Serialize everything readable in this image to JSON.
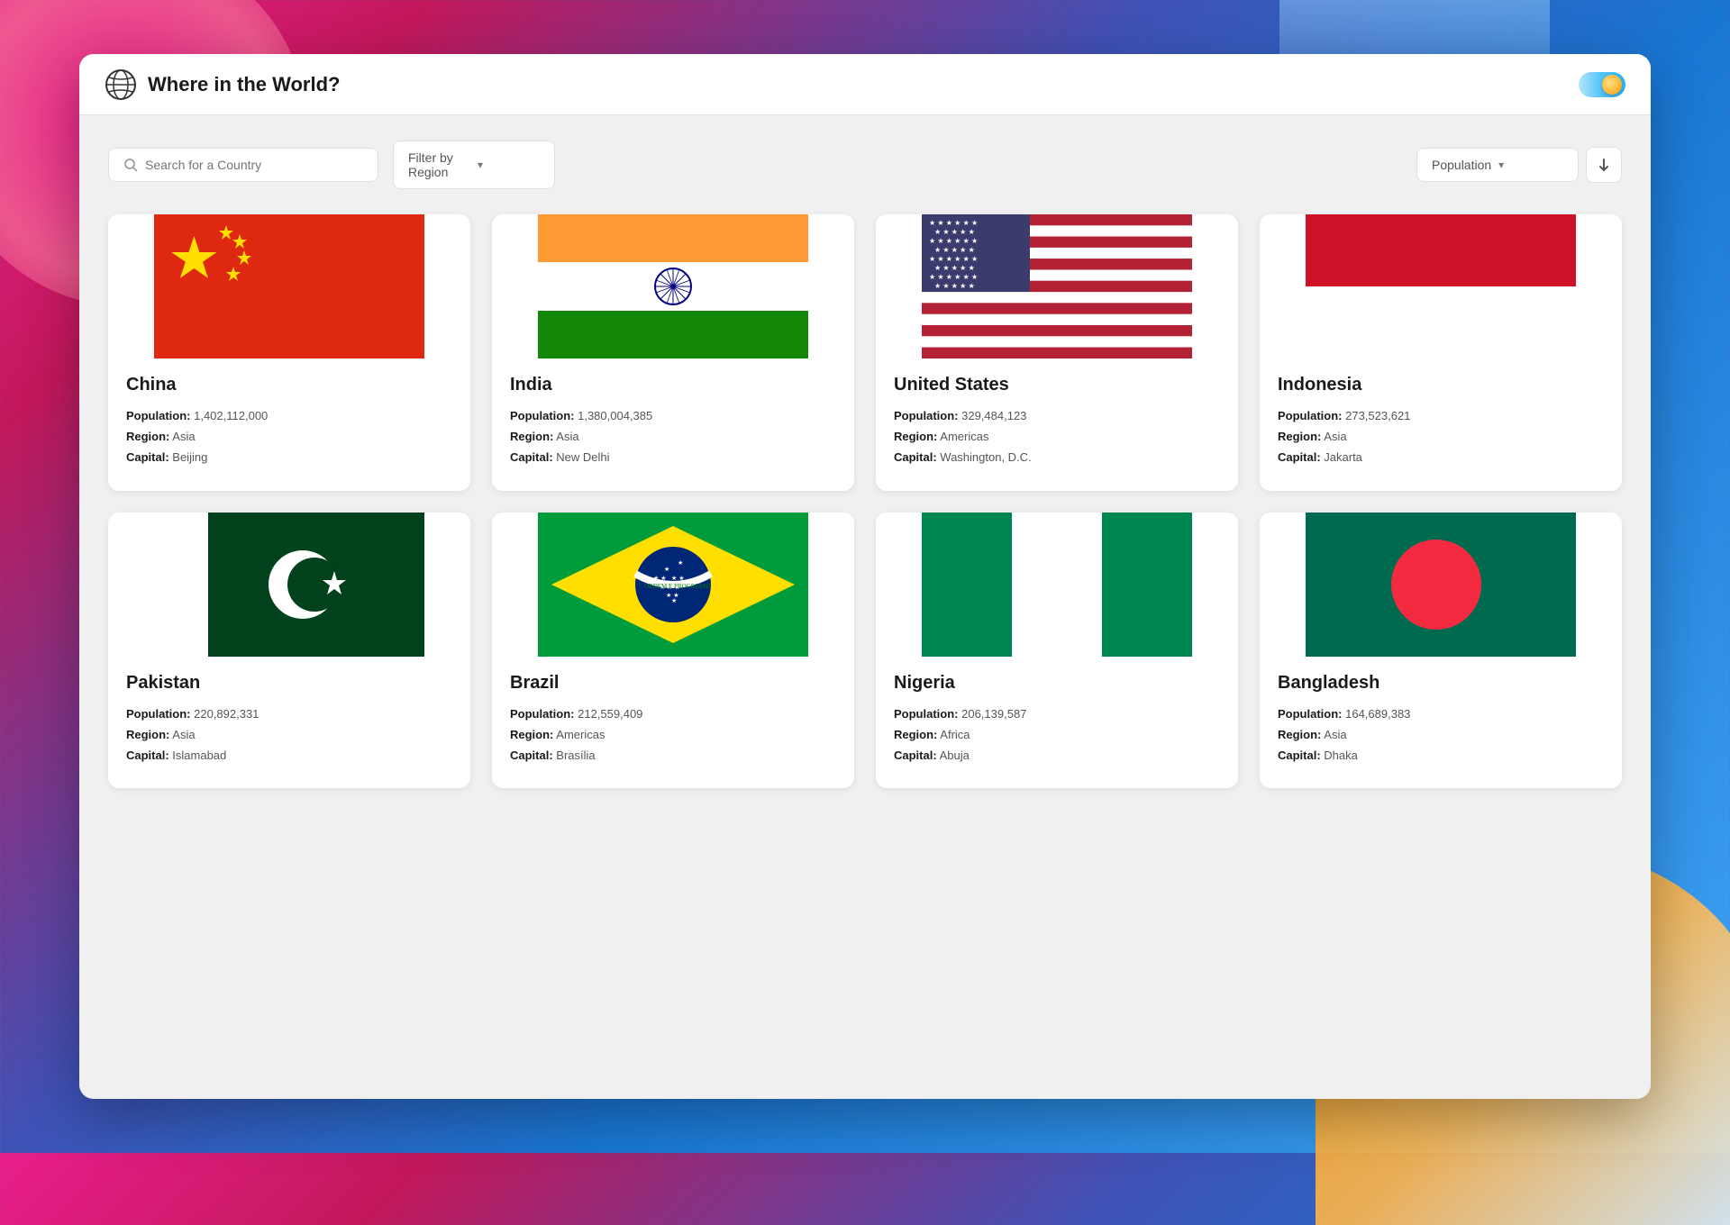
{
  "app": {
    "title": "Where in the World?",
    "toggle_state": "on"
  },
  "controls": {
    "search_placeholder": "Search for a Country",
    "filter_label": "Filter by Region",
    "sort_label": "Population",
    "sort_direction": "desc"
  },
  "countries": [
    {
      "name": "China",
      "population": "1,402,112,000",
      "region": "Asia",
      "capital": "Beijing",
      "flag_type": "china"
    },
    {
      "name": "India",
      "population": "1,380,004,385",
      "region": "Asia",
      "capital": "New Delhi",
      "flag_type": "india"
    },
    {
      "name": "United States",
      "population": "329,484,123",
      "region": "Americas",
      "capital": "Washington, D.C.",
      "flag_type": "usa"
    },
    {
      "name": "Indonesia",
      "population": "273,523,621",
      "region": "Asia",
      "capital": "Jakarta",
      "flag_type": "indonesia"
    },
    {
      "name": "Pakistan",
      "population": "220,892,331",
      "region": "Asia",
      "capital": "Islamabad",
      "flag_type": "pakistan"
    },
    {
      "name": "Brazil",
      "population": "212,559,409",
      "region": "Americas",
      "capital": "Brasília",
      "flag_type": "brazil"
    },
    {
      "name": "Nigeria",
      "population": "206,139,587",
      "region": "Africa",
      "capital": "Abuja",
      "flag_type": "nigeria"
    },
    {
      "name": "Bangladesh",
      "population": "164,689,383",
      "region": "Asia",
      "capital": "Dhaka",
      "flag_type": "bangladesh"
    }
  ],
  "labels": {
    "population_label": "Population:",
    "region_label": "Region:",
    "capital_label": "Capital:"
  }
}
